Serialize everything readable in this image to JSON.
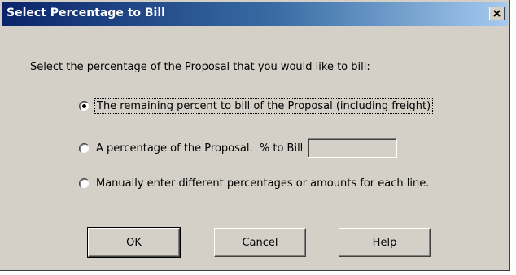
{
  "window": {
    "title": "Select Percentage to Bill",
    "close_glyph": "✕"
  },
  "prompt": "Select the percentage of the Proposal that you would like to bill:",
  "options": [
    {
      "label": "The remaining percent to bill of the Proposal (including freight)",
      "checked": true
    },
    {
      "label": "A percentage of the Proposal.  % to Bill",
      "checked": false
    },
    {
      "label": "Manually enter different percentages or amounts for each line.",
      "checked": false
    }
  ],
  "percent_input": {
    "value": ""
  },
  "buttons": {
    "ok": {
      "mnemonic": "O",
      "rest": "K"
    },
    "cancel": {
      "mnemonic": "C",
      "rest": "ancel"
    },
    "help": {
      "mnemonic": "H",
      "rest": "elp"
    }
  }
}
